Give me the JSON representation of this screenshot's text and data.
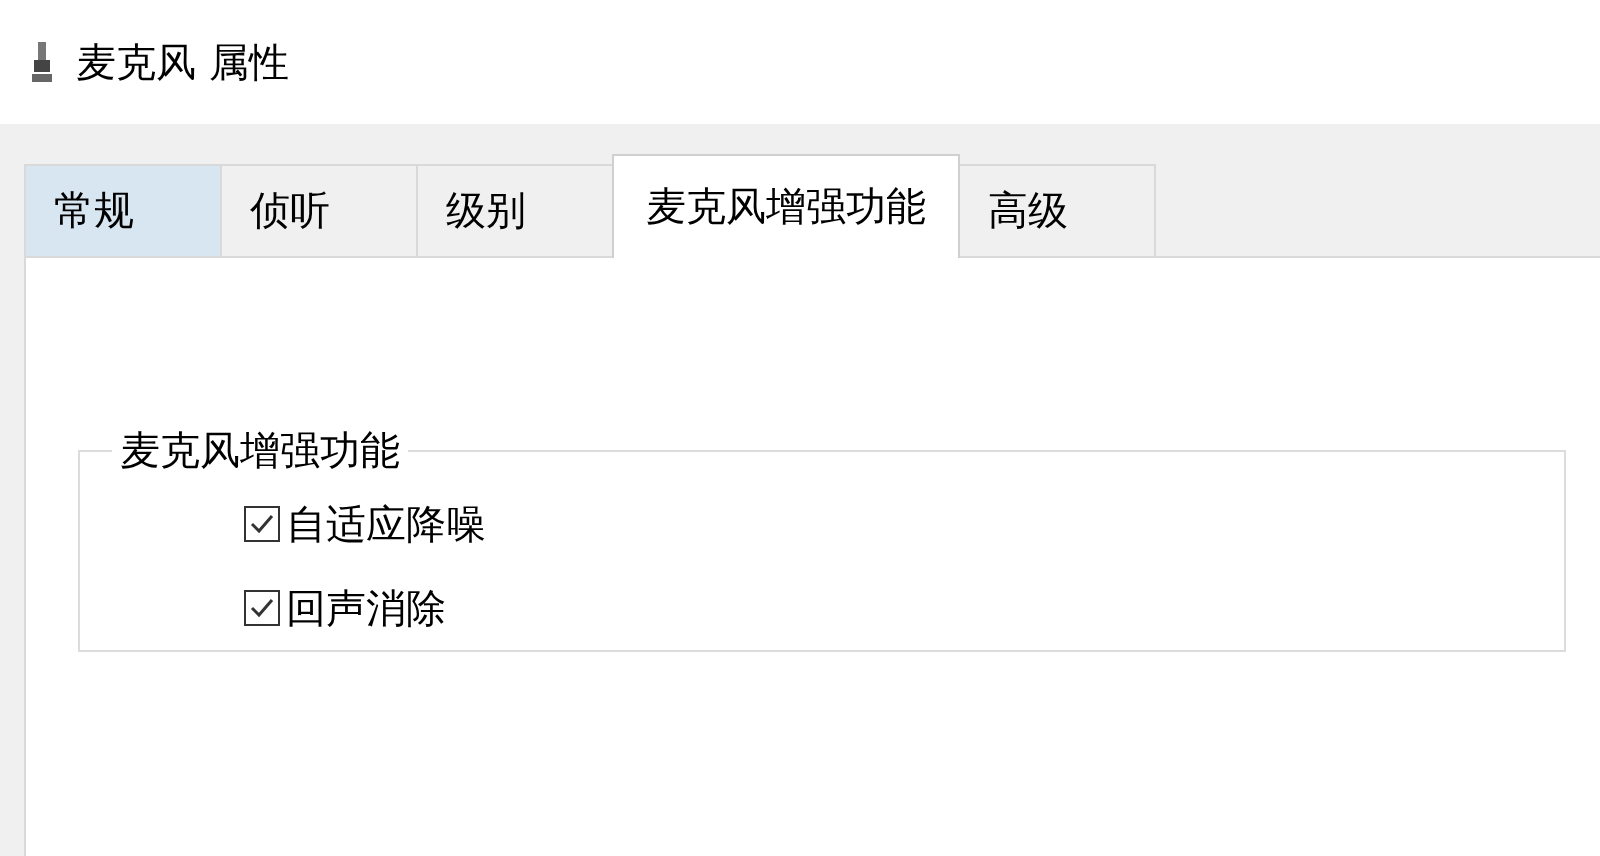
{
  "window": {
    "title": "麦克风 属性"
  },
  "tabs": [
    {
      "label": "常规",
      "selected": false,
      "hovered": true
    },
    {
      "label": "侦听",
      "selected": false,
      "hovered": false
    },
    {
      "label": "级别",
      "selected": false,
      "hovered": false
    },
    {
      "label": "麦克风增强功能",
      "selected": true,
      "hovered": false
    },
    {
      "label": "高级",
      "selected": false,
      "hovered": false
    }
  ],
  "group": {
    "title": "麦克风增强功能",
    "options": [
      {
        "label": "自适应降噪",
        "checked": true
      },
      {
        "label": "回声消除",
        "checked": true
      }
    ]
  }
}
